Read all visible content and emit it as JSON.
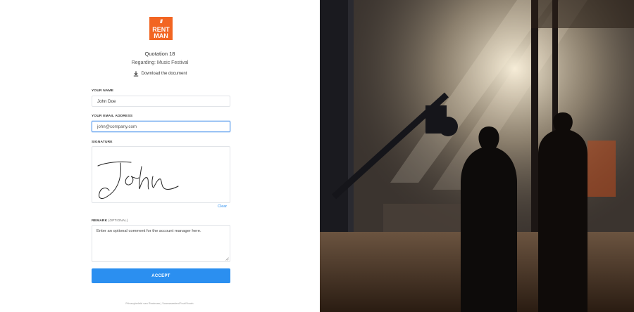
{
  "logo": {
    "line1": "RENT",
    "line2": "MAN",
    "stripes": "///"
  },
  "quotation": {
    "title": "Quotation 18",
    "regarding": "Regarding: Music Festival",
    "download_label": "Download the document"
  },
  "form": {
    "name_label": "YOUR NAME",
    "name_value": "John Doe",
    "email_label": "YOUR EMAIL ADDRESS",
    "email_placeholder": "john@company.com",
    "signature_label": "SIGNATURE",
    "clear_label": "Clear",
    "remark_label": "REMARK",
    "remark_optional": "(OPTIONAL)",
    "remark_placeholder": "Enter an optional comment for the account manager here.",
    "accept_label": "ACCEPT"
  },
  "footer": {
    "text": "Privacybeleid van Rentman | Voorwaarden/Fout/Voorb."
  },
  "colors": {
    "brand": "#f26522",
    "accent": "#2b8ff0",
    "focus": "#6aa6ef"
  },
  "icons": {
    "download": "download-icon"
  }
}
